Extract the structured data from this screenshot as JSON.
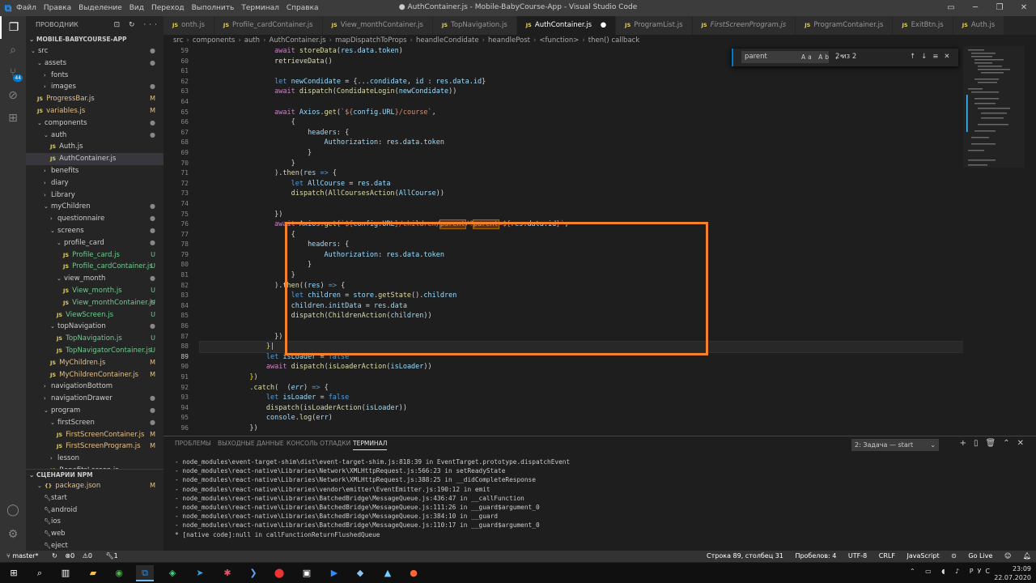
{
  "titlebar": {
    "menu": [
      "Файл",
      "Правка",
      "Выделение",
      "Вид",
      "Переход",
      "Выполнить",
      "Терминал",
      "Справка"
    ],
    "title": "● AuthContainer.js - Mobile-BabyCourse-App - Visual Studio Code"
  },
  "sidebar": {
    "header": "ПРОВОДНИК",
    "project": "MOBILE-BABYCOURSE-APP",
    "items": [
      {
        "label": "src",
        "depth": 0,
        "type": "folder",
        "open": true,
        "mark": "dot"
      },
      {
        "label": "assets",
        "depth": 1,
        "type": "folder",
        "open": true,
        "mark": "dot"
      },
      {
        "label": "fonts",
        "depth": 2,
        "type": "folder",
        "open": false,
        "mark": ""
      },
      {
        "label": "images",
        "depth": 2,
        "type": "folder",
        "open": false,
        "mark": "dot"
      },
      {
        "label": "ProgressBar.js",
        "depth": 1,
        "type": "file",
        "mark": "M"
      },
      {
        "label": "variables.js",
        "depth": 1,
        "type": "file",
        "mark": "M"
      },
      {
        "label": "components",
        "depth": 1,
        "type": "folder",
        "open": true,
        "mark": "dot"
      },
      {
        "label": "auth",
        "depth": 2,
        "type": "folder",
        "open": true,
        "mark": "dot"
      },
      {
        "label": "Auth.js",
        "depth": 3,
        "type": "file",
        "mark": ""
      },
      {
        "label": "AuthContainer.js",
        "depth": 3,
        "type": "file",
        "mark": "",
        "selected": true
      },
      {
        "label": "benefits",
        "depth": 2,
        "type": "folder",
        "open": false,
        "mark": ""
      },
      {
        "label": "diary",
        "depth": 2,
        "type": "folder",
        "open": false,
        "mark": ""
      },
      {
        "label": "Library",
        "depth": 2,
        "type": "folder",
        "open": false,
        "mark": ""
      },
      {
        "label": "myChildren",
        "depth": 2,
        "type": "folder",
        "open": true,
        "mark": "dot"
      },
      {
        "label": "questionnaire",
        "depth": 3,
        "type": "folder",
        "open": false,
        "mark": "dot"
      },
      {
        "label": "screens",
        "depth": 3,
        "type": "folder",
        "open": true,
        "mark": "dot"
      },
      {
        "label": "profile_card",
        "depth": 4,
        "type": "folder",
        "open": true,
        "mark": "dot"
      },
      {
        "label": "Profile_card.js",
        "depth": 5,
        "type": "file",
        "mark": "U"
      },
      {
        "label": "Profile_cardContainer.js",
        "depth": 5,
        "type": "file",
        "mark": "U"
      },
      {
        "label": "view_month",
        "depth": 4,
        "type": "folder",
        "open": true,
        "mark": "dot"
      },
      {
        "label": "View_month.js",
        "depth": 5,
        "type": "file",
        "mark": "U"
      },
      {
        "label": "View_monthContainer.js",
        "depth": 5,
        "type": "file",
        "mark": "U"
      },
      {
        "label": "ViewScreen.js",
        "depth": 4,
        "type": "file",
        "mark": "U"
      },
      {
        "label": "topNavigation",
        "depth": 3,
        "type": "folder",
        "open": true,
        "mark": "dot"
      },
      {
        "label": "TopNavigation.js",
        "depth": 4,
        "type": "file",
        "mark": "U"
      },
      {
        "label": "TopNavigatorContainer.js",
        "depth": 4,
        "type": "file",
        "mark": "U"
      },
      {
        "label": "MyChildren.js",
        "depth": 3,
        "type": "file",
        "mark": "M"
      },
      {
        "label": "MyChildrenContainer.js",
        "depth": 3,
        "type": "file",
        "mark": "M"
      },
      {
        "label": "navigationBottom",
        "depth": 2,
        "type": "folder",
        "open": false,
        "mark": ""
      },
      {
        "label": "navigationDrawer",
        "depth": 2,
        "type": "folder",
        "open": false,
        "mark": "dot"
      },
      {
        "label": "program",
        "depth": 2,
        "type": "folder",
        "open": true,
        "mark": "dot"
      },
      {
        "label": "firstScreen",
        "depth": 3,
        "type": "folder",
        "open": true,
        "mark": "dot"
      },
      {
        "label": "FirstScreenContainer.js",
        "depth": 4,
        "type": "file",
        "mark": "M"
      },
      {
        "label": "FirstScreenProgram.js",
        "depth": 4,
        "type": "file",
        "mark": "M"
      },
      {
        "label": "lesson",
        "depth": 3,
        "type": "folder",
        "open": false,
        "mark": ""
      },
      {
        "label": "BenefitsLesson.js",
        "depth": 3,
        "type": "file",
        "mark": ""
      }
    ],
    "npm_header": "СЦЕНАРИИ NPM",
    "npm_items": [
      {
        "label": "package.json",
        "depth": 1,
        "type": "pkg",
        "mark": "M"
      },
      {
        "label": "start",
        "depth": 2,
        "type": "script",
        "mark": ""
      },
      {
        "label": "android",
        "depth": 2,
        "type": "script",
        "mark": ""
      },
      {
        "label": "ios",
        "depth": 2,
        "type": "script",
        "mark": ""
      },
      {
        "label": "web",
        "depth": 2,
        "type": "script",
        "mark": ""
      },
      {
        "label": "eject",
        "depth": 2,
        "type": "script",
        "mark": ""
      }
    ]
  },
  "tabs": [
    {
      "label": "onth.js",
      "active": false,
      "italic": false
    },
    {
      "label": "Profile_cardContainer.js",
      "active": false,
      "italic": false
    },
    {
      "label": "View_monthContainer.js",
      "active": false,
      "italic": false
    },
    {
      "label": "TopNavigation.js",
      "active": false,
      "italic": false
    },
    {
      "label": "AuthContainer.js",
      "active": true,
      "italic": false,
      "modified": true
    },
    {
      "label": "ProgramList.js",
      "active": false,
      "italic": false
    },
    {
      "label": "FirstScreenProgram.js",
      "active": false,
      "italic": true
    },
    {
      "label": "ProgramContainer.js",
      "active": false,
      "italic": false
    },
    {
      "label": "ExitBtn.js",
      "active": false,
      "italic": false
    },
    {
      "label": "Auth.js",
      "active": false,
      "italic": false
    }
  ],
  "breadcrumbs": [
    "src",
    "components",
    "auth",
    "AuthContainer.js",
    "mapDispatchToProps",
    "heandleCondidate",
    "heandlePost",
    "<function>",
    "then() callback"
  ],
  "find": {
    "query": "parent",
    "options": "Aa Ab .*",
    "count": "2 из 2"
  },
  "editor": {
    "line_numbers": [
      59,
      60,
      61,
      62,
      63,
      64,
      65,
      66,
      67,
      68,
      69,
      70,
      71,
      72,
      73,
      74,
      75,
      76,
      77,
      78,
      79,
      80,
      81,
      82,
      83,
      84,
      85,
      86,
      87,
      88,
      89,
      90,
      91,
      92,
      93,
      94,
      95,
      96
    ],
    "current_line": 89
  },
  "panel": {
    "tabs": [
      "ПРОБЛЕМЫ",
      "ВЫХОДНЫЕ ДАННЫЕ",
      "КОНСОЛЬ ОТЛАДКИ",
      "ТЕРМИНАЛ"
    ],
    "active_tab": "ТЕРМИНАЛ",
    "task_select": "2: Задача — start",
    "terminal_lines": [
      "- node_modules\\event-target-shim\\dist\\event-target-shim.js:818:39 in EventTarget.prototype.dispatchEvent",
      "- node_modules\\react-native\\Libraries\\Network\\XMLHttpRequest.js:566:23 in setReadyState",
      "- node_modules\\react-native\\Libraries\\Network\\XMLHttpRequest.js:388:25 in __didCompleteResponse",
      "- node_modules\\react-native\\Libraries\\vendor\\emitter\\EventEmitter.js:190:12 in emit",
      "- node_modules\\react-native\\Libraries\\BatchedBridge\\MessageQueue.js:436:47 in __callFunction",
      "- node_modules\\react-native\\Libraries\\BatchedBridge\\MessageQueue.js:111:26 in __guard$argument_0",
      "- node_modules\\react-native\\Libraries\\BatchedBridge\\MessageQueue.js:384:10 in __guard",
      "- node_modules\\react-native\\Libraries\\BatchedBridge\\MessageQueue.js:110:17 in __guard$argument_0",
      "* [native code]:null in callFunctionReturnFlushedQueue"
    ]
  },
  "status": {
    "branch": "master*",
    "errors": "0",
    "warnings": "0",
    "tasks": "1",
    "position": "Строка 89, столбец 31",
    "spaces": "Пробелов: 4",
    "encoding": "UTF-8",
    "eol": "CRLF",
    "language": "JavaScript",
    "live": "Go Live"
  },
  "taskbar": {
    "lang": "РУС",
    "time": "23:09",
    "date": "22.07.2020"
  },
  "colors": {
    "accent": "#007acc",
    "highlight_box": "#f5812d",
    "modified": "#e2c08d",
    "untracked": "#73c991"
  }
}
